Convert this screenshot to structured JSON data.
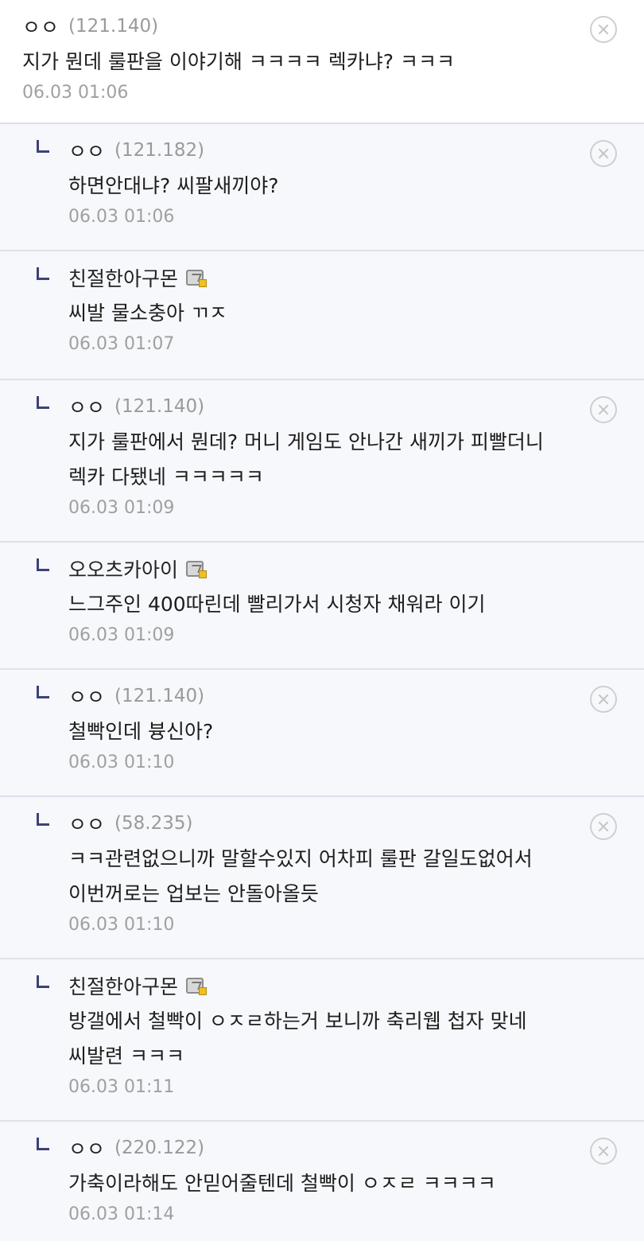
{
  "comments": [
    {
      "nick": "ㅇㅇ",
      "ip": "(121.140)",
      "text": "지가 뭔데 룰판을 이야기해 ㅋㅋㅋㅋ 렉카냐? ㅋㅋㅋ",
      "date": "06.03 01:06",
      "reply": false,
      "member": false,
      "deletable": true
    },
    {
      "nick": "ㅇㅇ",
      "ip": "(121.182)",
      "text": "하면안대냐? 씨팔새끼야?",
      "date": "06.03 01:06",
      "reply": true,
      "member": false,
      "deletable": true
    },
    {
      "nick": "친절한아구몬",
      "ip": "",
      "text": "씨발 물소충아 ㄲㅈ",
      "date": "06.03 01:07",
      "reply": true,
      "member": true,
      "deletable": false
    },
    {
      "nick": "ㅇㅇ",
      "ip": "(121.140)",
      "text": "지가 룰판에서 뭔데? 머니 게임도 안나간 새끼가 피빨더니 렉카 다됐네 ㅋㅋㅋㅋㅋ",
      "date": "06.03 01:09",
      "reply": true,
      "member": false,
      "deletable": true
    },
    {
      "nick": "오오츠카아이",
      "ip": "",
      "text": "느그주인 400따린데 빨리가서 시청자 채워라 이기",
      "date": "06.03 01:09",
      "reply": true,
      "member": true,
      "deletable": false
    },
    {
      "nick": "ㅇㅇ",
      "ip": "(121.140)",
      "text": "철빡인데 븅신아?",
      "date": "06.03 01:10",
      "reply": true,
      "member": false,
      "deletable": true
    },
    {
      "nick": "ㅇㅇ",
      "ip": "(58.235)",
      "text": "ㅋㅋ관련없으니까 말할수있지 어차피 룰판 갈일도없어서 이번꺼로는 업보는 안돌아올듯",
      "date": "06.03 01:10",
      "reply": true,
      "member": false,
      "deletable": true
    },
    {
      "nick": "친절한아구몬",
      "ip": "",
      "text": "방갤에서 철빡이 ㅇㅈㄹ하는거 보니까 축리웹 첩자 맞네 씨발련 ㅋㅋㅋ",
      "date": "06.03 01:11",
      "reply": true,
      "member": true,
      "deletable": false
    },
    {
      "nick": "ㅇㅇ",
      "ip": "(220.122)",
      "text": "가축이라해도 안믿어줄텐데 철빡이 ㅇㅈㄹ ㅋㅋㅋㅋ",
      "date": "06.03 01:14",
      "reply": true,
      "member": false,
      "deletable": true
    }
  ],
  "icons": {
    "reply": "reply-arrow-icon",
    "member": "gallery-member-icon",
    "delete": "delete-circle-x-icon"
  },
  "colors": {
    "reply_mark": "#3c4278",
    "reply_bg": "#f7f8fb",
    "divider": "#dfe0ea",
    "meta_text": "#9a9a9a"
  }
}
